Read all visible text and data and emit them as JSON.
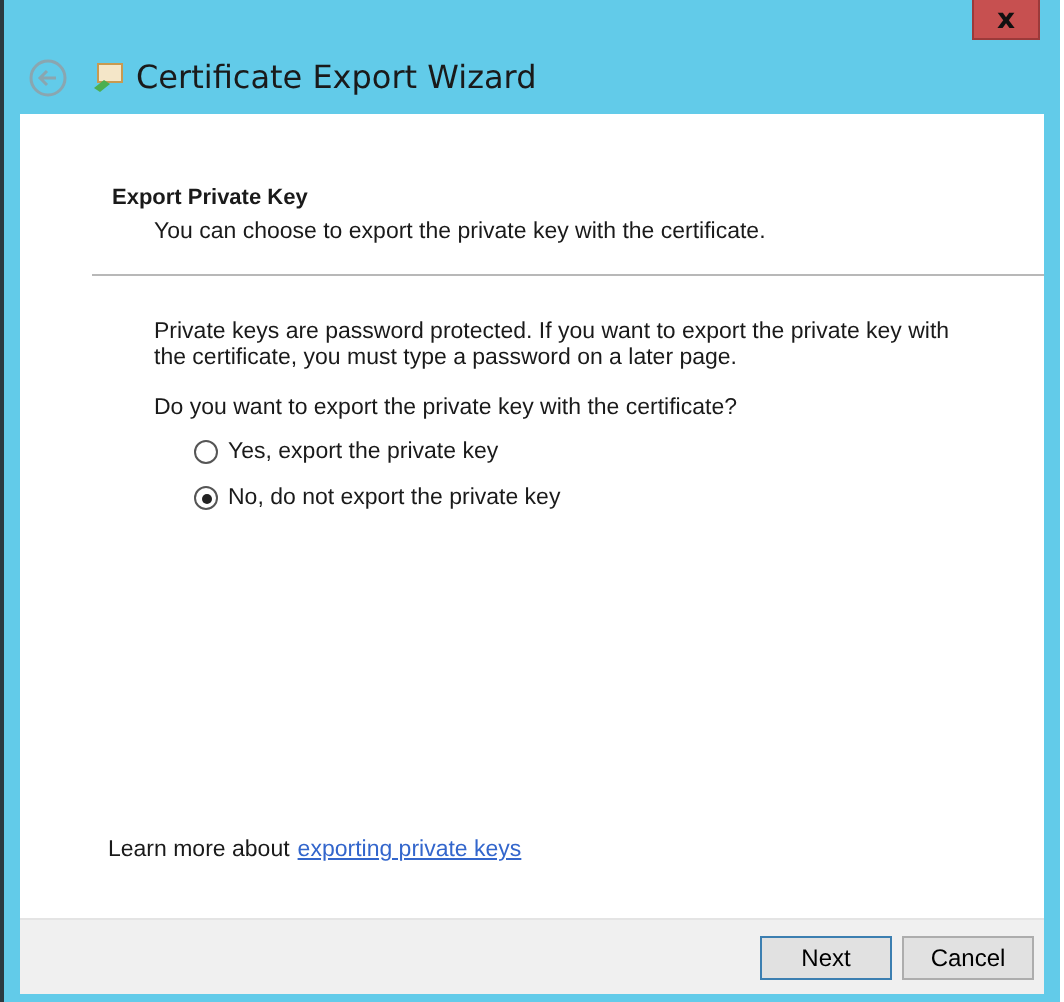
{
  "window": {
    "title": "Certificate Export Wizard",
    "close_glyph": "x"
  },
  "page": {
    "heading": "Export Private Key",
    "subheading": "You can choose to export the private key with the certificate.",
    "description": "Private keys are password protected. If you want to export the private key with the certificate, you must type a password on a later page.",
    "question": "Do you want to export the private key with the certificate?",
    "options": [
      {
        "label": "Yes, export the private key",
        "selected": false
      },
      {
        "label": "No, do not export the private key",
        "selected": true
      }
    ],
    "learn_more": {
      "text": "Learn more about",
      "link": "exporting private keys"
    }
  },
  "buttons": [
    {
      "label": "Next",
      "default": true
    },
    {
      "label": "Cancel",
      "default": false
    }
  ]
}
